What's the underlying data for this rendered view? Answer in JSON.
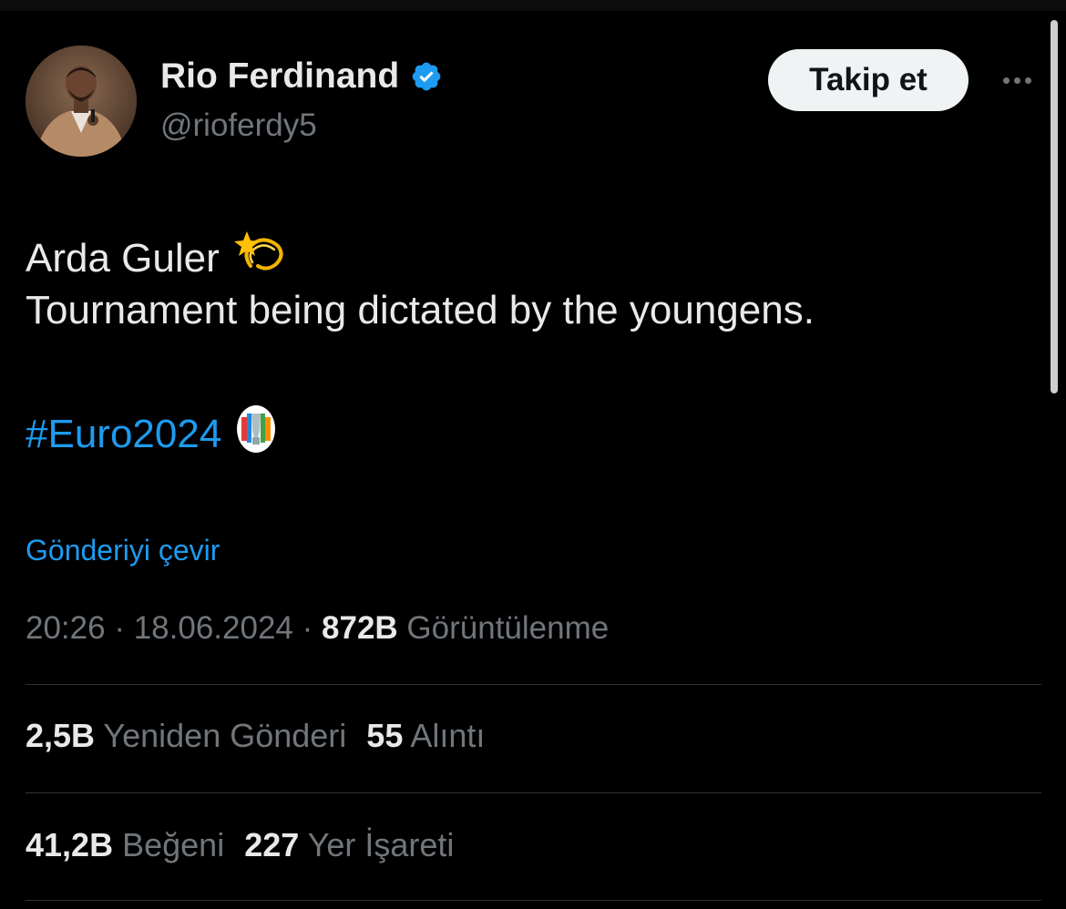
{
  "author": {
    "display_name": "Rio Ferdinand",
    "handle": "@rioferdy5",
    "verified_icon": "verified-badge-icon",
    "avatar": "profile-photo"
  },
  "actions": {
    "follow_label": "Takip et",
    "more_icon": "more-horizontal-icon"
  },
  "tweet": {
    "line1": "Arda Guler",
    "line1_emoji": "dizzy-star-emoji",
    "line2": "Tournament being dictated by the youngens.",
    "hashtag": "#Euro2024",
    "hashtag_emoji": "euro-2024-trophy-emoji"
  },
  "translate_label": "Gönderiyi çevir",
  "meta": {
    "time": "20:26",
    "separator": "·",
    "date": "18.06.2024",
    "views_count": "872B",
    "views_label": "Görüntülenme"
  },
  "stats": {
    "reposts_count": "2,5B",
    "reposts_label": "Yeniden Gönderi",
    "quotes_count": "55",
    "quotes_label": "Alıntı",
    "likes_count": "41,2B",
    "likes_label": "Beğeni",
    "bookmarks_count": "227",
    "bookmarks_label": "Yer İşareti"
  },
  "colors": {
    "background": "#000000",
    "text_primary": "#e7e9ea",
    "text_secondary": "#71767b",
    "accent": "#1d9bf0",
    "divider": "#2f3336",
    "button_bg": "#eff3f4"
  }
}
